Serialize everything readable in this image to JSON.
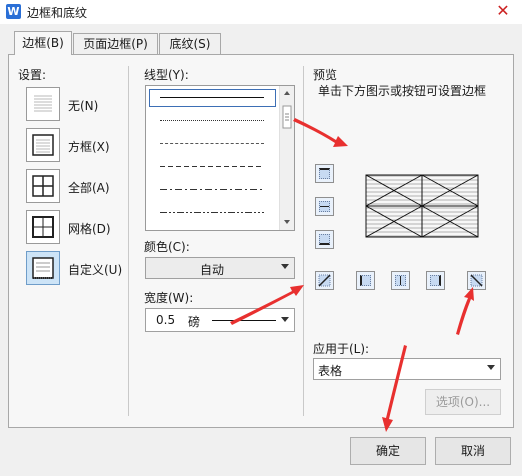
{
  "window": {
    "title": "边框和底纹",
    "app_icon": "W",
    "close_glyph": "✕"
  },
  "tabs": [
    {
      "label": "边框(B)",
      "active": true
    },
    {
      "label": "页面边框(P)",
      "active": false
    },
    {
      "label": "底纹(S)",
      "active": false
    }
  ],
  "settings": {
    "heading": "设置:",
    "items": [
      {
        "label": "无(N)",
        "icon": "no-border-icon"
      },
      {
        "label": "方框(X)",
        "icon": "box-border-icon"
      },
      {
        "label": "全部(A)",
        "icon": "all-borders-icon"
      },
      {
        "label": "网格(D)",
        "icon": "grid-border-icon"
      },
      {
        "label": "自定义(U)",
        "icon": "custom-border-icon",
        "selected": true
      }
    ]
  },
  "line_style": {
    "heading": "线型(Y):",
    "options": [
      "solid",
      "dotted",
      "dashed-fine",
      "dashed",
      "dash-dot",
      "dash-dot-dot"
    ],
    "selected": "solid"
  },
  "color": {
    "heading": "颜色(C):",
    "value": "自动"
  },
  "width": {
    "heading": "宽度(W):",
    "value": "0.5",
    "unit": "磅"
  },
  "preview": {
    "heading": "预览",
    "hint": "单击下方图示或按钮可设置边框",
    "left_buttons": [
      "top-border-icon",
      "inside-horizontal-border-icon",
      "bottom-border-icon"
    ],
    "bottom_buttons": [
      "diagonal-up-border-icon",
      "left-border-icon",
      "inside-vertical-border-icon",
      "right-border-icon",
      "diagonal-down-border-icon"
    ]
  },
  "apply_to": {
    "heading": "应用于(L):",
    "value": "表格"
  },
  "options_button": {
    "label": "选项(O)...",
    "enabled": false
  },
  "footer": {
    "ok_label": "确定",
    "cancel_label": "取消"
  },
  "colors": {
    "annotation_arrow": "#e8302f",
    "selection_blue": "#3d6fb5",
    "tab_border": "#a8a8a8"
  }
}
